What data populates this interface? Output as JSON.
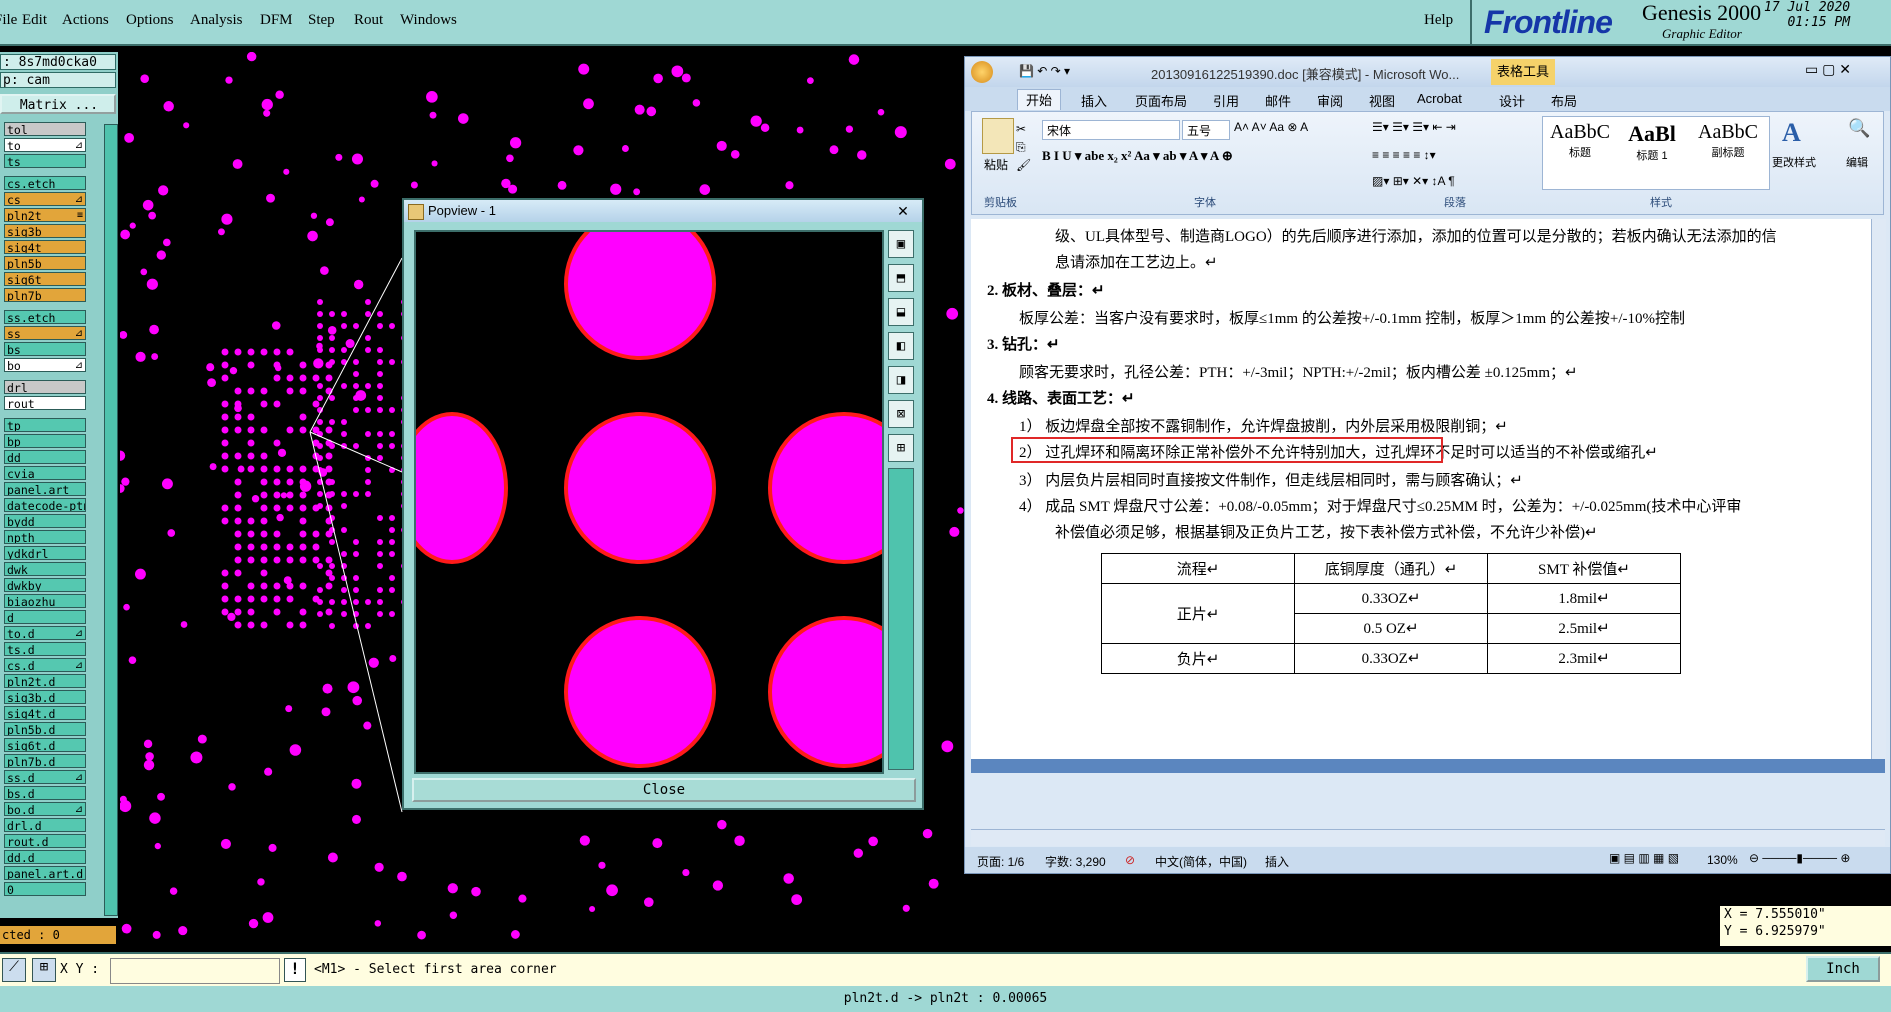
{
  "menu": {
    "items": [
      "File",
      "Edit",
      "Actions",
      "Options",
      "Analysis",
      "DFM",
      "Step",
      "Rout",
      "Windows"
    ],
    "help": "Help"
  },
  "brand": {
    "logo": "Frontline",
    "app": "Genesis 2000",
    "subtitle": "Graphic Editor",
    "date": "17 Jul 2020",
    "time": "01:15 PM"
  },
  "left_panel": {
    "job": ": 8s7md0cka0",
    "step": "p: cam",
    "matrix": "Matrix ...",
    "layers": [
      {
        "name": "tol",
        "color": "grey"
      },
      {
        "name": "to",
        "color": "white",
        "mark": "⊿"
      },
      {
        "name": "ts",
        "color": "teal"
      },
      {
        "name": "cs.etch",
        "color": "teal"
      },
      {
        "name": "cs",
        "color": "orange",
        "mark": "⊿"
      },
      {
        "name": "pln2t",
        "color": "orange",
        "mark": "≡"
      },
      {
        "name": "sig3b",
        "color": "orange"
      },
      {
        "name": "sig4t",
        "color": "orange"
      },
      {
        "name": "pln5b",
        "color": "orange"
      },
      {
        "name": "sig6t",
        "color": "orange"
      },
      {
        "name": "pln7b",
        "color": "orange"
      },
      {
        "name": "ss.etch",
        "color": "teal"
      },
      {
        "name": "ss",
        "color": "orange",
        "mark": "⊿"
      },
      {
        "name": "bs",
        "color": "teal"
      },
      {
        "name": "bo",
        "color": "white",
        "mark": "⊿"
      },
      {
        "name": "drl",
        "color": "grey"
      },
      {
        "name": "rout",
        "color": "white"
      },
      {
        "name": "tp",
        "color": "teal"
      },
      {
        "name": "bp",
        "color": "teal"
      },
      {
        "name": "dd",
        "color": "teal"
      },
      {
        "name": "cvia",
        "color": "teal"
      },
      {
        "name": "panel.art",
        "color": "teal"
      },
      {
        "name": "datecode-ptn",
        "color": "teal"
      },
      {
        "name": "bydd",
        "color": "teal"
      },
      {
        "name": "npth",
        "color": "teal"
      },
      {
        "name": "ydkdrl",
        "color": "teal"
      },
      {
        "name": "dwk",
        "color": "teal"
      },
      {
        "name": "dwkby",
        "color": "teal"
      },
      {
        "name": "biaozhu",
        "color": "teal"
      },
      {
        "name": "d",
        "color": "teal"
      },
      {
        "name": "to.d",
        "color": "teal",
        "mark": "⊿"
      },
      {
        "name": "ts.d",
        "color": "teal"
      },
      {
        "name": "cs.d",
        "color": "teal",
        "mark": "⊿"
      },
      {
        "name": "pln2t.d",
        "color": "teal"
      },
      {
        "name": "sig3b.d",
        "color": "teal"
      },
      {
        "name": "sig4t.d",
        "color": "teal"
      },
      {
        "name": "pln5b.d",
        "color": "teal"
      },
      {
        "name": "sig6t.d",
        "color": "teal"
      },
      {
        "name": "pln7b.d",
        "color": "teal"
      },
      {
        "name": "ss.d",
        "color": "teal",
        "mark": "⊿"
      },
      {
        "name": "bs.d",
        "color": "teal"
      },
      {
        "name": "bo.d",
        "color": "teal",
        "mark": "⊿"
      },
      {
        "name": "drl.d",
        "color": "teal"
      },
      {
        "name": "rout.d",
        "color": "teal"
      },
      {
        "name": "dd.d",
        "color": "teal"
      },
      {
        "name": "panel.art.d",
        "color": "teal"
      },
      {
        "name": "0",
        "color": "teal"
      }
    ],
    "selected": "cted : 0"
  },
  "popview": {
    "title": "Popview - 1",
    "close_x": "✕",
    "close_button": "Close"
  },
  "command": {
    "xy_label": "X Y :",
    "xy_value": "",
    "prompt": "<M1> - Select first area corner",
    "unit": "Inch",
    "coord_x": "X = 7.555010\"",
    "coord_y": "Y = 6.925979\""
  },
  "status": "pln2t.d -> pln2t : 0.00065",
  "word": {
    "title": "20130916122519390.doc [兼容模式] - Microsoft Wo...",
    "context_tab": "表格工具",
    "tabs": [
      "开始",
      "插入",
      "页面布局",
      "引用",
      "邮件",
      "审阅",
      "视图",
      "Acrobat",
      "设计",
      "布局"
    ],
    "font_name": "宋体",
    "font_size": "五号",
    "paste": "粘贴",
    "groups": [
      "剪贴板",
      "字体",
      "段落",
      "样式",
      "编辑"
    ],
    "styles": [
      {
        "sample": "AaBbC",
        "name": "标题"
      },
      {
        "sample": "AaBl",
        "name": "标题 1"
      },
      {
        "sample": "AaBbC",
        "name": "副标题"
      }
    ],
    "change_styles": "更改样式",
    "edit": "编辑",
    "doc_lines": [
      "级、UL具体型号、制造商LOGO）的先后顺序进行添加，添加的位置可以是分散的；若板内确认无法添加的信",
      "息请添加在工艺边上。↵",
      "2.   板材、叠层：↵",
      "板厚公差：当客户没有要求时，板厚≤1mm 的公差按+/-0.1mm 控制，板厚＞1mm 的公差按+/-10%控制",
      "3.   钻孔：↵",
      "顾客无要求时，孔径公差：PTH：+/-3mil；NPTH:+/-2mil；板内槽公差  ±0.125mm；↵",
      "4.   线路、表面工艺：↵",
      "1）  板边焊盘全部按不露铜制作，允许焊盘披削，内外层采用极限削铜；↵",
      "2）  过孔焊环和隔离环除正常补偿外不允许特别加大，过孔焊环不足时可以适当的不补偿或缩孔↵",
      "3）  内层负片层相同时直接按文件制作，但走线层相同时，需与顾客确认；↵",
      "4）  成品 SMT 焊盘尺寸公差：+0.08/-0.05mm；对于焊盘尺寸≤0.25MM 时，公差为：+/-0.025mm(技术中心评审",
      "补偿值必须足够，根据基铜及正负片工艺，按下表补偿方式补偿，不允许少补偿)↵"
    ],
    "table": {
      "headers": [
        "流程↵",
        "底铜厚度（通孔）↵",
        "SMT 补偿值↵"
      ],
      "pos": "正片↵",
      "neg": "负片↵",
      "rows": [
        [
          "0.33OZ↵",
          "1.8mil↵"
        ],
        [
          "0.5 OZ↵",
          "2.5mil↵"
        ],
        [
          "0.33OZ↵",
          "2.3mil↵"
        ]
      ]
    },
    "status": {
      "page": "页面: 1/6",
      "words": "字数: 3,290",
      "lang": "中文(简体，中国)",
      "mode": "插入",
      "zoom": "130%"
    }
  }
}
